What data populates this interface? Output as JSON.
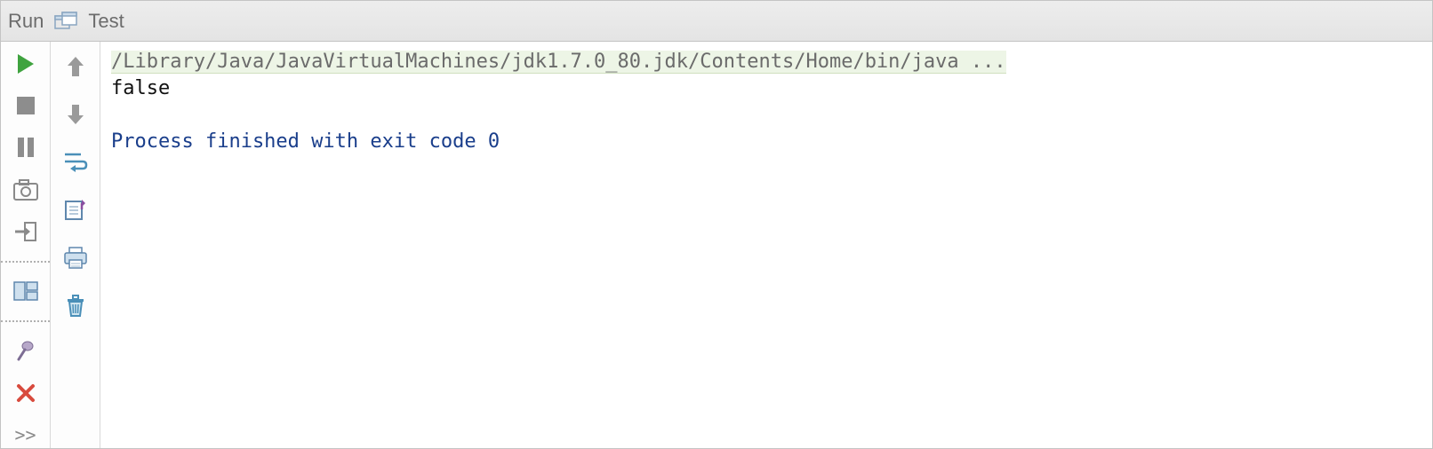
{
  "header": {
    "title": "Run",
    "tab_label": "Test"
  },
  "left": {
    "run": "run",
    "stop": "stop",
    "pause": "pause",
    "dump": "dump",
    "exit": "exit",
    "layout": "layout",
    "pin": "pin",
    "close": "close",
    "more": ">>"
  },
  "toolbar": {
    "scroll_up": "up",
    "scroll_down": "down",
    "wrap": "wrap",
    "export": "export",
    "print": "print",
    "clear": "clear"
  },
  "console": {
    "command": "/Library/Java/JavaVirtualMachines/jdk1.7.0_80.jdk/Contents/Home/bin/java ...",
    "stdout": "false",
    "exit_message": "Process finished with exit code 0"
  }
}
